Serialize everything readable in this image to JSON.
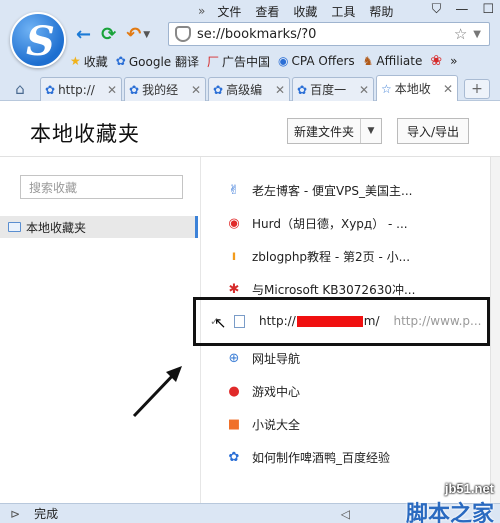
{
  "window": {
    "menu_chevron": "»",
    "menu": [
      "文件",
      "查看",
      "收藏",
      "工具",
      "帮助"
    ],
    "win_buttons": [
      "⛉",
      "—",
      "☐"
    ]
  },
  "url": {
    "value": "se://bookmarks/?0"
  },
  "bookmarks_bar": [
    {
      "icon": "star-icon",
      "label": "收藏"
    },
    {
      "icon": "paw-icon",
      "label": "Google 翻译"
    },
    {
      "icon": "ad-icon",
      "label": "广告中国"
    },
    {
      "icon": "cpa-icon",
      "label": "CPA Offers"
    },
    {
      "icon": "affiliate-icon",
      "label": "Affiliate"
    }
  ],
  "tabs": [
    {
      "label": "http://",
      "active": false
    },
    {
      "label": "我的经",
      "active": false
    },
    {
      "label": "高级编",
      "active": false
    },
    {
      "label": "百度一",
      "active": false
    },
    {
      "label": "本地收",
      "active": true
    }
  ],
  "page": {
    "title": "本地收藏夹",
    "new_folder": "新建文件夹",
    "import_export": "导入/导出",
    "search_placeholder": "搜索收藏",
    "sidebar_folder": "本地收藏夹"
  },
  "items": [
    {
      "icon": "✌",
      "color": "#2b6fd6",
      "label": "老左博客 - 便宜VPS_美国主..."
    },
    {
      "icon": "◉",
      "color": "#e02a2a",
      "label": "Hurd（胡日德，Хурд） - ..."
    },
    {
      "icon": "ı",
      "color": "#f29b1b",
      "label": "zblogphp教程 - 第2页 - 小..."
    },
    {
      "icon": "✱",
      "color": "#d62b2b",
      "label": "与Microsoft KB3072630冲..."
    }
  ],
  "highlight": {
    "url_prefix": "http://",
    "url_suffix": "m/",
    "url_dim": "http://www.p..."
  },
  "items2": [
    {
      "icon": "⊕",
      "color": "#3d7fd6",
      "label": "网址导航"
    },
    {
      "icon": "●",
      "color": "#e02a2a",
      "label": "游戏中心"
    },
    {
      "icon": "■",
      "color": "#f0702a",
      "label": "小说大全"
    },
    {
      "icon": "✿",
      "color": "#2b6fd6",
      "label": "如何制作啤酒鸭_百度经验"
    }
  ],
  "status": {
    "text": "完成"
  },
  "watermark": {
    "line1": "jb51.net",
    "line2": "脚本之家"
  }
}
